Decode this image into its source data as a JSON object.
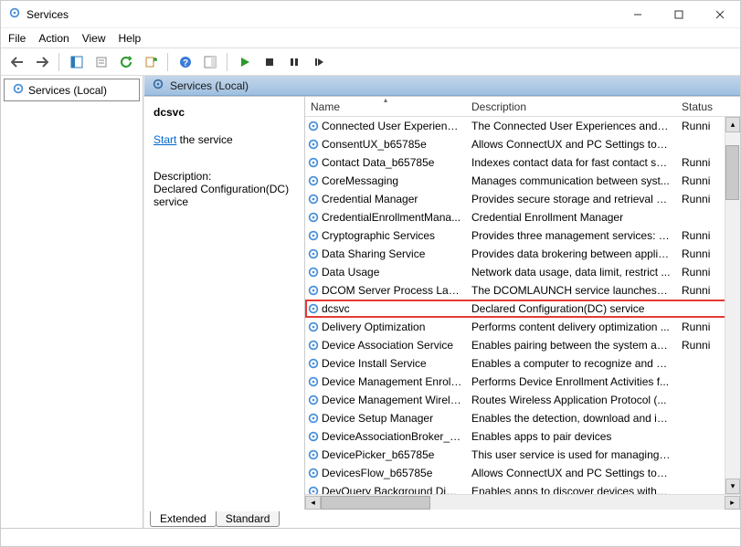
{
  "window": {
    "title": "Services"
  },
  "menu": {
    "file": "File",
    "action": "Action",
    "view": "View",
    "help": "Help"
  },
  "tree": {
    "root": "Services (Local)"
  },
  "pane_header": "Services (Local)",
  "detail": {
    "service_name": "dcsvc",
    "start_link": "Start",
    "start_suffix": " the service",
    "desc_label": "Description:",
    "desc_text": "Declared Configuration(DC) service"
  },
  "columns": {
    "name": "Name",
    "description": "Description",
    "status": "Status"
  },
  "tabs": {
    "extended": "Extended",
    "standard": "Standard"
  },
  "rows": [
    {
      "name": "Connected User Experience...",
      "desc": "The Connected User Experiences and Te...",
      "status": "Runni",
      "hl": false
    },
    {
      "name": "ConsentUX_b65785e",
      "desc": "Allows ConnectUX and PC Settings to C...",
      "status": "",
      "hl": false
    },
    {
      "name": "Contact Data_b65785e",
      "desc": "Indexes contact data for fast contact se...",
      "status": "Runni",
      "hl": false
    },
    {
      "name": "CoreMessaging",
      "desc": "Manages communication between syst...",
      "status": "Runni",
      "hl": false
    },
    {
      "name": "Credential Manager",
      "desc": "Provides secure storage and retrieval of ...",
      "status": "Runni",
      "hl": false
    },
    {
      "name": "CredentialEnrollmentMana...",
      "desc": "Credential Enrollment Manager",
      "status": "",
      "hl": false
    },
    {
      "name": "Cryptographic Services",
      "desc": "Provides three management services: C...",
      "status": "Runni",
      "hl": false
    },
    {
      "name": "Data Sharing Service",
      "desc": "Provides data brokering between applic...",
      "status": "Runni",
      "hl": false
    },
    {
      "name": "Data Usage",
      "desc": "Network data usage, data limit, restrict ...",
      "status": "Runni",
      "hl": false
    },
    {
      "name": "DCOM Server Process Laun...",
      "desc": "The DCOMLAUNCH service launches C...",
      "status": "Runni",
      "hl": false
    },
    {
      "name": "dcsvc",
      "desc": "Declared Configuration(DC) service",
      "status": "",
      "hl": true
    },
    {
      "name": "Delivery Optimization",
      "desc": "Performs content delivery optimization ...",
      "status": "Runni",
      "hl": false
    },
    {
      "name": "Device Association Service",
      "desc": "Enables pairing between the system an...",
      "status": "Runni",
      "hl": false
    },
    {
      "name": "Device Install Service",
      "desc": "Enables a computer to recognize and a...",
      "status": "",
      "hl": false
    },
    {
      "name": "Device Management Enroll...",
      "desc": "Performs Device Enrollment Activities f...",
      "status": "",
      "hl": false
    },
    {
      "name": "Device Management Wirele...",
      "desc": "Routes Wireless Application Protocol (...",
      "status": "",
      "hl": false
    },
    {
      "name": "Device Setup Manager",
      "desc": "Enables the detection, download and in...",
      "status": "",
      "hl": false
    },
    {
      "name": "DeviceAssociationBroker_b...",
      "desc": "Enables apps to pair devices",
      "status": "",
      "hl": false
    },
    {
      "name": "DevicePicker_b65785e",
      "desc": "This user service is used for managing t...",
      "status": "",
      "hl": false
    },
    {
      "name": "DevicesFlow_b65785e",
      "desc": "Allows ConnectUX and PC Settings to C...",
      "status": "",
      "hl": false
    },
    {
      "name": "DevQuery Background Disc...",
      "desc": "Enables apps to discover devices with a ...",
      "status": "",
      "hl": false
    }
  ]
}
